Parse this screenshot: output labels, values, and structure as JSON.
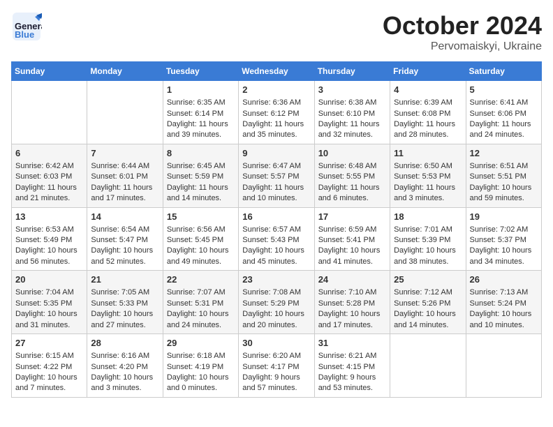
{
  "header": {
    "logo_general": "General",
    "logo_blue": "Blue",
    "month": "October 2024",
    "location": "Pervomaiskyi, Ukraine"
  },
  "weekdays": [
    "Sunday",
    "Monday",
    "Tuesday",
    "Wednesday",
    "Thursday",
    "Friday",
    "Saturday"
  ],
  "weeks": [
    [
      {
        "day": "",
        "content": ""
      },
      {
        "day": "",
        "content": ""
      },
      {
        "day": "1",
        "content": "Sunrise: 6:35 AM\nSunset: 6:14 PM\nDaylight: 11 hours and 39 minutes."
      },
      {
        "day": "2",
        "content": "Sunrise: 6:36 AM\nSunset: 6:12 PM\nDaylight: 11 hours and 35 minutes."
      },
      {
        "day": "3",
        "content": "Sunrise: 6:38 AM\nSunset: 6:10 PM\nDaylight: 11 hours and 32 minutes."
      },
      {
        "day": "4",
        "content": "Sunrise: 6:39 AM\nSunset: 6:08 PM\nDaylight: 11 hours and 28 minutes."
      },
      {
        "day": "5",
        "content": "Sunrise: 6:41 AM\nSunset: 6:06 PM\nDaylight: 11 hours and 24 minutes."
      }
    ],
    [
      {
        "day": "6",
        "content": "Sunrise: 6:42 AM\nSunset: 6:03 PM\nDaylight: 11 hours and 21 minutes."
      },
      {
        "day": "7",
        "content": "Sunrise: 6:44 AM\nSunset: 6:01 PM\nDaylight: 11 hours and 17 minutes."
      },
      {
        "day": "8",
        "content": "Sunrise: 6:45 AM\nSunset: 5:59 PM\nDaylight: 11 hours and 14 minutes."
      },
      {
        "day": "9",
        "content": "Sunrise: 6:47 AM\nSunset: 5:57 PM\nDaylight: 11 hours and 10 minutes."
      },
      {
        "day": "10",
        "content": "Sunrise: 6:48 AM\nSunset: 5:55 PM\nDaylight: 11 hours and 6 minutes."
      },
      {
        "day": "11",
        "content": "Sunrise: 6:50 AM\nSunset: 5:53 PM\nDaylight: 11 hours and 3 minutes."
      },
      {
        "day": "12",
        "content": "Sunrise: 6:51 AM\nSunset: 5:51 PM\nDaylight: 10 hours and 59 minutes."
      }
    ],
    [
      {
        "day": "13",
        "content": "Sunrise: 6:53 AM\nSunset: 5:49 PM\nDaylight: 10 hours and 56 minutes."
      },
      {
        "day": "14",
        "content": "Sunrise: 6:54 AM\nSunset: 5:47 PM\nDaylight: 10 hours and 52 minutes."
      },
      {
        "day": "15",
        "content": "Sunrise: 6:56 AM\nSunset: 5:45 PM\nDaylight: 10 hours and 49 minutes."
      },
      {
        "day": "16",
        "content": "Sunrise: 6:57 AM\nSunset: 5:43 PM\nDaylight: 10 hours and 45 minutes."
      },
      {
        "day": "17",
        "content": "Sunrise: 6:59 AM\nSunset: 5:41 PM\nDaylight: 10 hours and 41 minutes."
      },
      {
        "day": "18",
        "content": "Sunrise: 7:01 AM\nSunset: 5:39 PM\nDaylight: 10 hours and 38 minutes."
      },
      {
        "day": "19",
        "content": "Sunrise: 7:02 AM\nSunset: 5:37 PM\nDaylight: 10 hours and 34 minutes."
      }
    ],
    [
      {
        "day": "20",
        "content": "Sunrise: 7:04 AM\nSunset: 5:35 PM\nDaylight: 10 hours and 31 minutes."
      },
      {
        "day": "21",
        "content": "Sunrise: 7:05 AM\nSunset: 5:33 PM\nDaylight: 10 hours and 27 minutes."
      },
      {
        "day": "22",
        "content": "Sunrise: 7:07 AM\nSunset: 5:31 PM\nDaylight: 10 hours and 24 minutes."
      },
      {
        "day": "23",
        "content": "Sunrise: 7:08 AM\nSunset: 5:29 PM\nDaylight: 10 hours and 20 minutes."
      },
      {
        "day": "24",
        "content": "Sunrise: 7:10 AM\nSunset: 5:28 PM\nDaylight: 10 hours and 17 minutes."
      },
      {
        "day": "25",
        "content": "Sunrise: 7:12 AM\nSunset: 5:26 PM\nDaylight: 10 hours and 14 minutes."
      },
      {
        "day": "26",
        "content": "Sunrise: 7:13 AM\nSunset: 5:24 PM\nDaylight: 10 hours and 10 minutes."
      }
    ],
    [
      {
        "day": "27",
        "content": "Sunrise: 6:15 AM\nSunset: 4:22 PM\nDaylight: 10 hours and 7 minutes."
      },
      {
        "day": "28",
        "content": "Sunrise: 6:16 AM\nSunset: 4:20 PM\nDaylight: 10 hours and 3 minutes."
      },
      {
        "day": "29",
        "content": "Sunrise: 6:18 AM\nSunset: 4:19 PM\nDaylight: 10 hours and 0 minutes."
      },
      {
        "day": "30",
        "content": "Sunrise: 6:20 AM\nSunset: 4:17 PM\nDaylight: 9 hours and 57 minutes."
      },
      {
        "day": "31",
        "content": "Sunrise: 6:21 AM\nSunset: 4:15 PM\nDaylight: 9 hours and 53 minutes."
      },
      {
        "day": "",
        "content": ""
      },
      {
        "day": "",
        "content": ""
      }
    ]
  ]
}
